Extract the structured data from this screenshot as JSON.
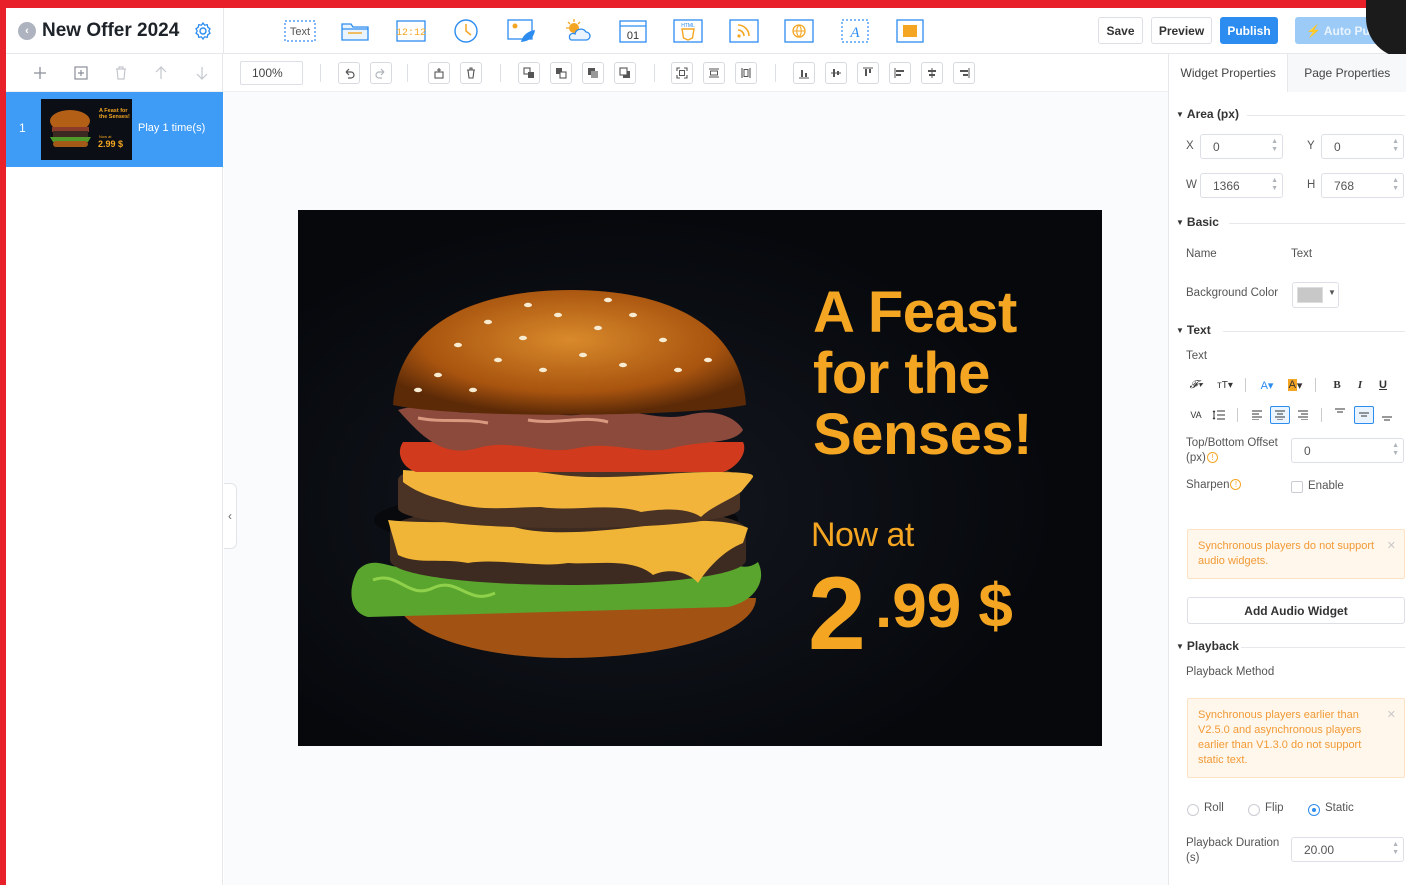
{
  "header": {
    "title": "New Offer 2024",
    "save_label": "Save",
    "preview_label": "Preview",
    "publish_label": "Publish",
    "auto_publish_label": "⚡ Auto Pub",
    "widgets": [
      {
        "name": "text-widget-icon",
        "label": "Text"
      },
      {
        "name": "folder-widget-icon"
      },
      {
        "name": "digital-clock-widget-icon",
        "label": "12:12"
      },
      {
        "name": "clock-widget-icon"
      },
      {
        "name": "weather-image-widget-icon"
      },
      {
        "name": "weather-widget-icon"
      },
      {
        "name": "calendar-widget-icon",
        "label": "01"
      },
      {
        "name": "html-widget-icon",
        "label": "HTML"
      },
      {
        "name": "rss-widget-icon"
      },
      {
        "name": "web-widget-icon"
      },
      {
        "name": "scroll-text-widget-icon",
        "label": "A"
      },
      {
        "name": "color-block-widget-icon"
      }
    ]
  },
  "slides": [
    {
      "number": "1",
      "play_label": "Play 1 time(s)",
      "thumb_title": "A Feast for the Senses!",
      "thumb_now": "Now at",
      "thumb_price": "2.99 $"
    }
  ],
  "toolbar": {
    "zoom": "100%"
  },
  "canvas": {
    "headline": "A Feast\nfor the\nSenses!",
    "now_at": "Now at",
    "price_int": "2",
    "price_dec": ".99 $"
  },
  "props": {
    "tab_widget": "Widget Properties",
    "tab_page": "Page Properties",
    "area_title": "Area (px)",
    "x_label": "X",
    "x_value": "0",
    "y_label": "Y",
    "y_value": "0",
    "w_label": "W",
    "w_value": "1366",
    "h_label": "H",
    "h_value": "768",
    "basic_title": "Basic",
    "name_label": "Name",
    "name_value": "Text",
    "bg_color_label": "Background Color",
    "text_title": "Text",
    "text_label": "Text",
    "offset_label_1": "Top/Bottom Offset",
    "offset_label_2": "(px)",
    "offset_value": "0",
    "sharpen_label": "Sharpen",
    "enable_label": "Enable",
    "warn_audio": "Synchronous players do not support audio widgets.",
    "add_audio_label": "Add Audio Widget",
    "playback_title": "Playback",
    "playback_method_label": "Playback Method",
    "warn_static": "Synchronous players earlier than V2.5.0 and asynchronous players earlier than V1.3.0 do not support static text.",
    "roll_label": "Roll",
    "flip_label": "Flip",
    "static_label": "Static",
    "selected_method": "Static",
    "duration_label_1": "Playback Duration",
    "duration_label_2": "(s)",
    "duration_value": "20.00"
  },
  "colors": {
    "accent": "#2d8cf0",
    "headline": "#f4a623",
    "brand_red": "#e8202a",
    "background_swatch": "#c8c8c8"
  }
}
